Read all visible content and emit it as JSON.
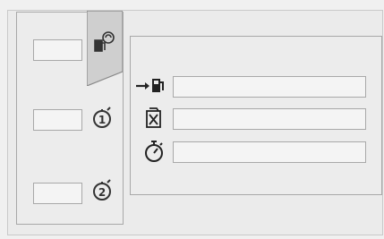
{
  "left_panel": {
    "items": [
      {
        "icon": "fuel-consumption-icon",
        "value": ""
      },
      {
        "icon": "trip-1-icon",
        "value": ""
      },
      {
        "icon": "trip-2-icon",
        "value": ""
      }
    ]
  },
  "main_panel": {
    "rows": [
      {
        "icon": "fuel-range-icon",
        "value": ""
      },
      {
        "icon": "fuel-can-icon",
        "value": ""
      },
      {
        "icon": "stopwatch-icon",
        "value": ""
      }
    ]
  },
  "colors": {
    "line": "#7a7a7a",
    "box_border": "#a8a8a8",
    "background": "#ececec"
  }
}
